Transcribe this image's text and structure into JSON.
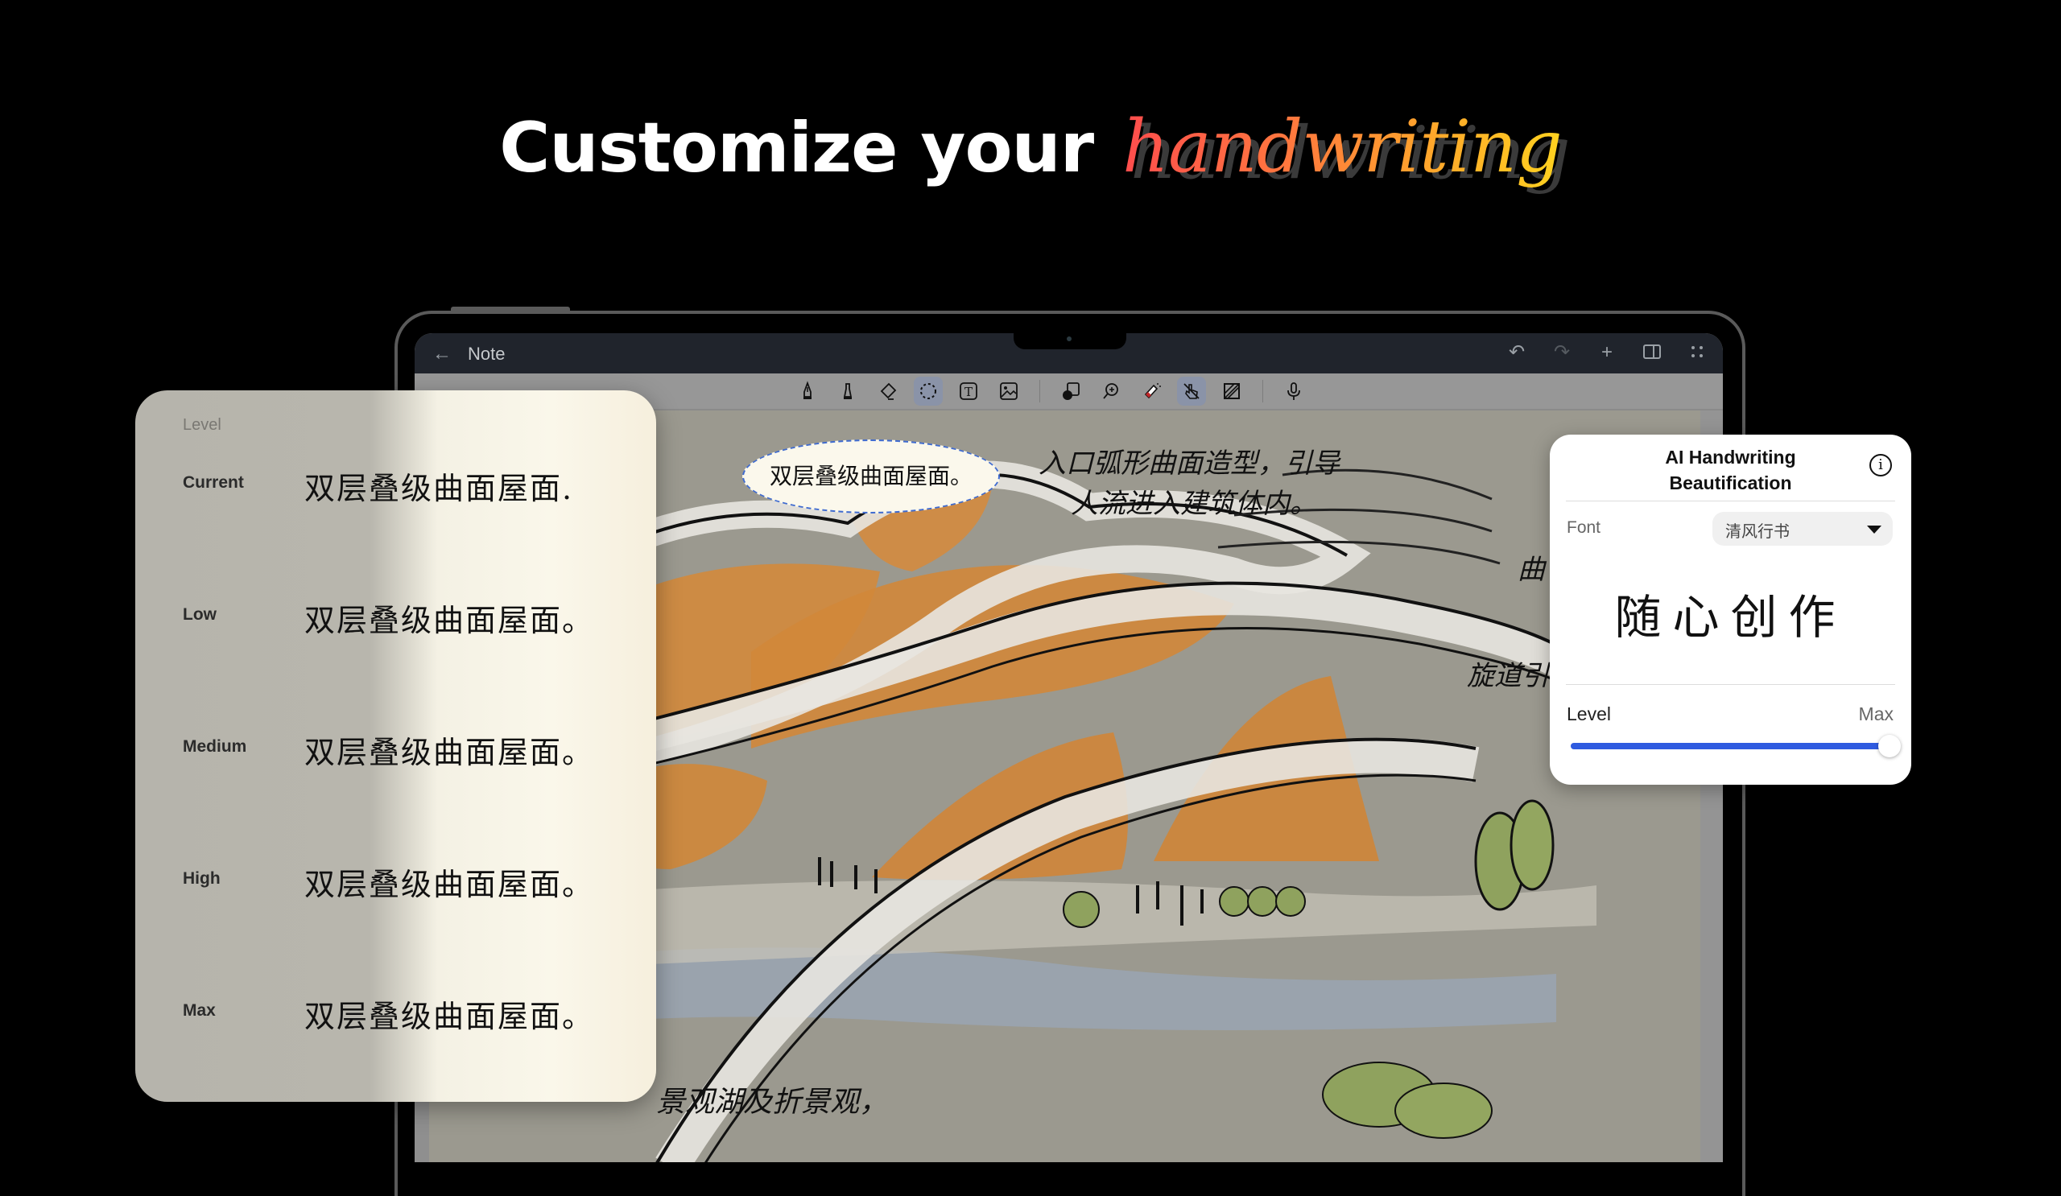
{
  "headline": {
    "plain": "Customize your",
    "script": "handwriting",
    "gradient_colors": [
      "#ff4d4d",
      "#ff7a3d",
      "#ffa62b",
      "#ffd21f"
    ]
  },
  "app": {
    "title": "Note",
    "back_icon": "arrow-left-icon",
    "top_actions": [
      {
        "name": "undo",
        "icon": "undo-icon",
        "glyph": "↶",
        "enabled": true
      },
      {
        "name": "redo",
        "icon": "redo-icon",
        "glyph": "↷",
        "enabled": false
      },
      {
        "name": "add",
        "icon": "plus-icon",
        "glyph": "+",
        "enabled": true
      },
      {
        "name": "split-view",
        "icon": "panel-icon",
        "glyph": "▯",
        "enabled": true
      },
      {
        "name": "more",
        "icon": "dots-grid-icon",
        "glyph": "⁘",
        "enabled": true
      }
    ],
    "tools": [
      {
        "name": "pen",
        "icon": "fountain-pen-icon",
        "active": false
      },
      {
        "name": "marker",
        "icon": "marker-icon",
        "active": false
      },
      {
        "name": "eraser",
        "icon": "eraser-icon",
        "active": false
      },
      {
        "name": "lasso",
        "icon": "lasso-select-icon",
        "active": true
      },
      {
        "name": "text",
        "icon": "text-box-icon",
        "active": false
      },
      {
        "name": "image",
        "icon": "image-icon",
        "active": false
      },
      {
        "name": "shape",
        "icon": "shape-icon",
        "active": false
      },
      {
        "name": "zoom",
        "icon": "zoom-in-icon",
        "active": false
      },
      {
        "name": "laser",
        "icon": "laser-pointer-icon",
        "active": false
      },
      {
        "name": "finger-draw",
        "icon": "finger-draw-off-icon",
        "active": true
      },
      {
        "name": "background",
        "icon": "hatch-pattern-icon",
        "active": false
      },
      {
        "name": "voice",
        "icon": "microphone-icon",
        "active": false
      }
    ],
    "accent": "#2f5be0"
  },
  "canvas": {
    "selected_text": "双层叠级曲面屋面。",
    "annotation_1_line1": "入口弧形曲面造型，引导",
    "annotation_1_line2": "人流进入建筑体内。",
    "annotation_2": "曲",
    "annotation_3": "旋道引",
    "annotation_bottom": "景观湖及折景观，"
  },
  "level_panel": {
    "header": "Level",
    "rows": [
      {
        "label": "Current",
        "sample": "双层叠级曲面屋面."
      },
      {
        "label": "Low",
        "sample": "双层叠级曲面屋面。"
      },
      {
        "label": "Medium",
        "sample": "双层叠级曲面屋面。"
      },
      {
        "label": "High",
        "sample": "双层叠级曲面屋面。"
      },
      {
        "label": "Max",
        "sample": "双层叠级曲面屋面。"
      }
    ]
  },
  "ai_panel": {
    "title_line1": "AI Handwriting",
    "title_line2": "Beautification",
    "info_icon": "info-icon",
    "font_label": "Font",
    "font_value": "清风行书",
    "preview_text": "随心创作",
    "level_label": "Level",
    "level_value": "Max",
    "level_fraction": 1.0
  }
}
